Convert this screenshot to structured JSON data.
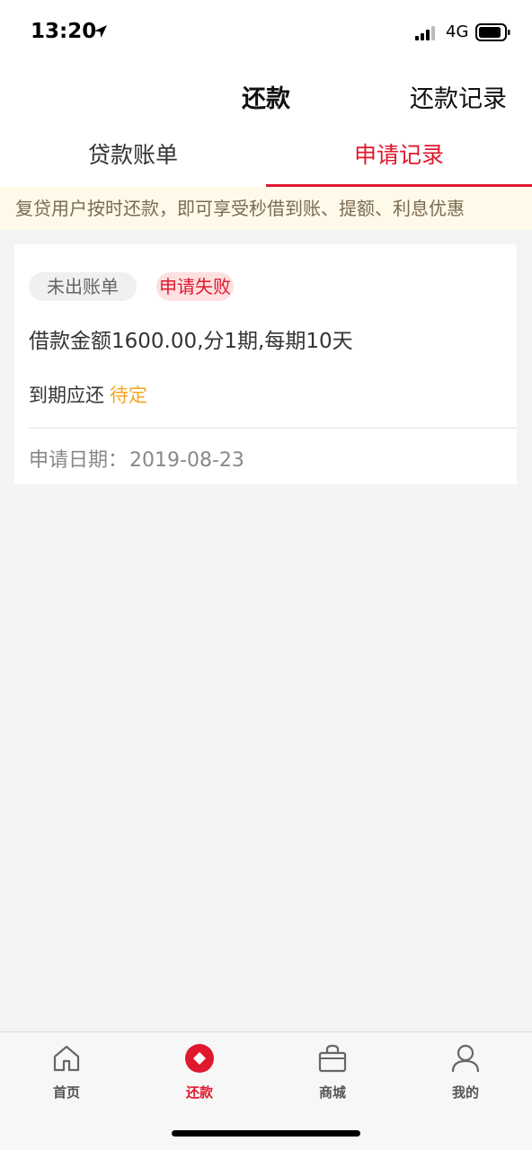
{
  "status": {
    "time": "13:20",
    "network": "4G"
  },
  "navbar": {
    "title": "还款",
    "action": "还款记录"
  },
  "tabs": [
    {
      "label": "贷款账单",
      "active": false
    },
    {
      "label": "申请记录",
      "active": true
    }
  ],
  "notice": "复贷用户按时还款，即可享受秒借到账、提额、利息优惠",
  "record": {
    "tag_bill": "未出账单",
    "tag_status": "申请失败",
    "loan_summary": "借款金额1600.00,分1期,每期10天",
    "due_label": "到期应还",
    "due_value": "待定",
    "date_label": "申请日期：",
    "date_value": "2019-08-23"
  },
  "tabbar": [
    {
      "label": "首页",
      "icon": "home-icon"
    },
    {
      "label": "还款",
      "icon": "repay-icon",
      "active": true
    },
    {
      "label": "商城",
      "icon": "shop-bag-icon"
    },
    {
      "label": "我的",
      "icon": "user-icon"
    }
  ],
  "colors": {
    "accent": "#e0182d",
    "pending": "#f5a623",
    "notice_bg": "#fff9ea"
  }
}
